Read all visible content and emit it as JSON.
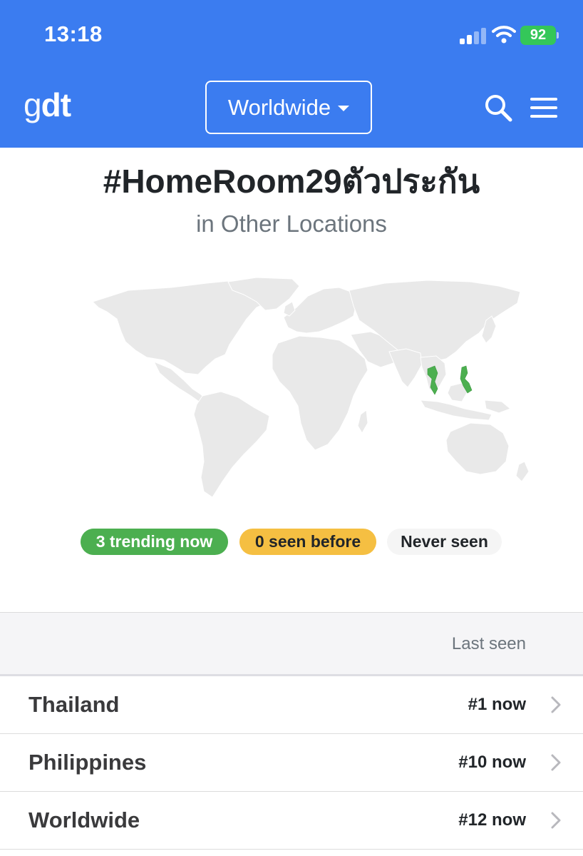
{
  "status_bar": {
    "time": "13:18",
    "battery": "92"
  },
  "navbar": {
    "logo_light": "g",
    "logo_bold": "dt",
    "location_button": "Worldwide",
    "icons": [
      "search-icon",
      "menu-icon",
      "caret-down-icon",
      "wifi-icon",
      "signal-icon",
      "battery-icon"
    ]
  },
  "hashtag": {
    "title": "#HomeRoom29ตัวประกัน",
    "subtitle": "in Other Locations"
  },
  "map": {
    "highlight_color": "#4caf50",
    "base_color": "#e8e8e8"
  },
  "legend": {
    "trending": "3 trending now",
    "seen_before": "0 seen before",
    "never_seen": "Never seen"
  },
  "table": {
    "column_header": "Last seen",
    "rows": [
      {
        "country": "Thailand",
        "rank": "#1 now"
      },
      {
        "country": "Philippines",
        "rank": "#10 now"
      },
      {
        "country": "Worldwide",
        "rank": "#12 now"
      }
    ]
  },
  "colors": {
    "header_blue": "#3b7cf0",
    "trending_green": "#4caf50",
    "seen_yellow": "#f5bf42",
    "never_gray": "#f5f5f5"
  }
}
